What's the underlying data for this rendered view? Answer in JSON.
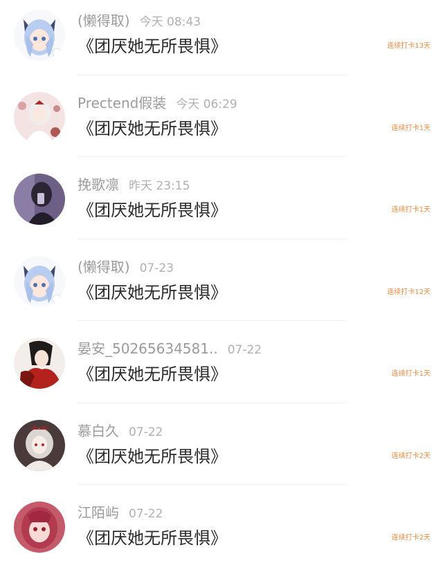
{
  "items": [
    {
      "name": "(懒得取)",
      "time": "今天 08:43",
      "title": "《团厌她无所畏惧》",
      "streak": "连续打卡13天",
      "avatar": "avatar-girl-blue-hair"
    },
    {
      "name": "Prectend假装",
      "time": "今天 06:29",
      "title": "《团厌她无所畏惧》",
      "streak": "连续打卡1天",
      "avatar": "avatar-girl-white-dress"
    },
    {
      "name": "挽歌凛",
      "time": "昨天 23:15",
      "title": "《团厌她无所畏惧》",
      "streak": "连续打卡1天",
      "avatar": "avatar-dark-figure"
    },
    {
      "name": "(懒得取)",
      "time": "07-23",
      "title": "《团厌她无所畏惧》",
      "streak": "连续打卡12天",
      "avatar": "avatar-girl-blue-hair"
    },
    {
      "name": "晏安_50265634581..",
      "time": "07-22",
      "title": "《团厌她无所畏惧》",
      "streak": "连续打卡1天",
      "avatar": "avatar-man-red-robe"
    },
    {
      "name": "慕白久",
      "time": "07-22",
      "title": "《团厌她无所畏惧》",
      "streak": "连续打卡2天",
      "avatar": "avatar-girl-white-lace"
    },
    {
      "name": "江陌屿",
      "time": "07-22",
      "title": "《团厌她无所畏惧》",
      "streak": "连续打卡2天",
      "avatar": "avatar-girl-red-hair"
    }
  ]
}
